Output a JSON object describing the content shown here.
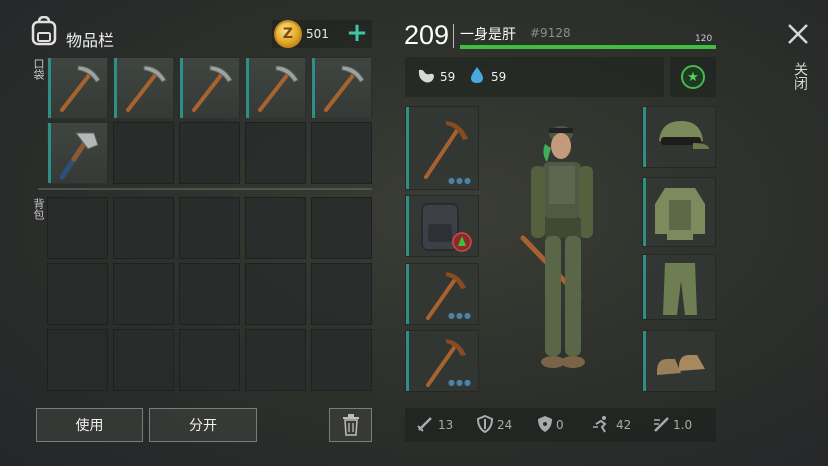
{
  "inventory": {
    "title": "物品栏",
    "coin_symbol": "Z",
    "coins": "501",
    "plus_label": "+",
    "pocket_label": "口袋",
    "backpack_label": "背包",
    "pocket_items": [
      "pickaxe",
      "pickaxe",
      "pickaxe",
      "pickaxe",
      "pickaxe",
      "hatchet"
    ],
    "use_label": "使用",
    "split_label": "分开"
  },
  "character": {
    "level": "209",
    "name": "一身是肝",
    "id": "#9128",
    "xp_value": "120",
    "xp_fraction": 1.0,
    "hunger": "59",
    "thirst": "59",
    "weapon_slots": [
      "pickaxe",
      "backpack",
      "pickaxe",
      "pickaxe"
    ],
    "armor_slots": [
      "cap",
      "jacket",
      "pants",
      "boots"
    ]
  },
  "close_label": "关闭",
  "stats": {
    "attack": "13",
    "defense": "24",
    "radiation": "0",
    "speed": "42",
    "weapon_speed": "1.0"
  },
  "icons": {
    "bag": "backpack-icon",
    "hunger": "stomach-icon",
    "thirst": "water-drop-icon",
    "star": "star-badge-icon",
    "trash": "trash-icon",
    "close": "close-icon",
    "attack": "sword-icon",
    "defense": "shield-icon",
    "radiation": "radiation-icon",
    "speed": "running-icon",
    "weapon_speed": "weapon-speed-icon"
  },
  "colors": {
    "accent": "#2e8f84",
    "xp": "#3fbf3f",
    "coin": "#e0a525",
    "plus": "#3fc6a8"
  }
}
